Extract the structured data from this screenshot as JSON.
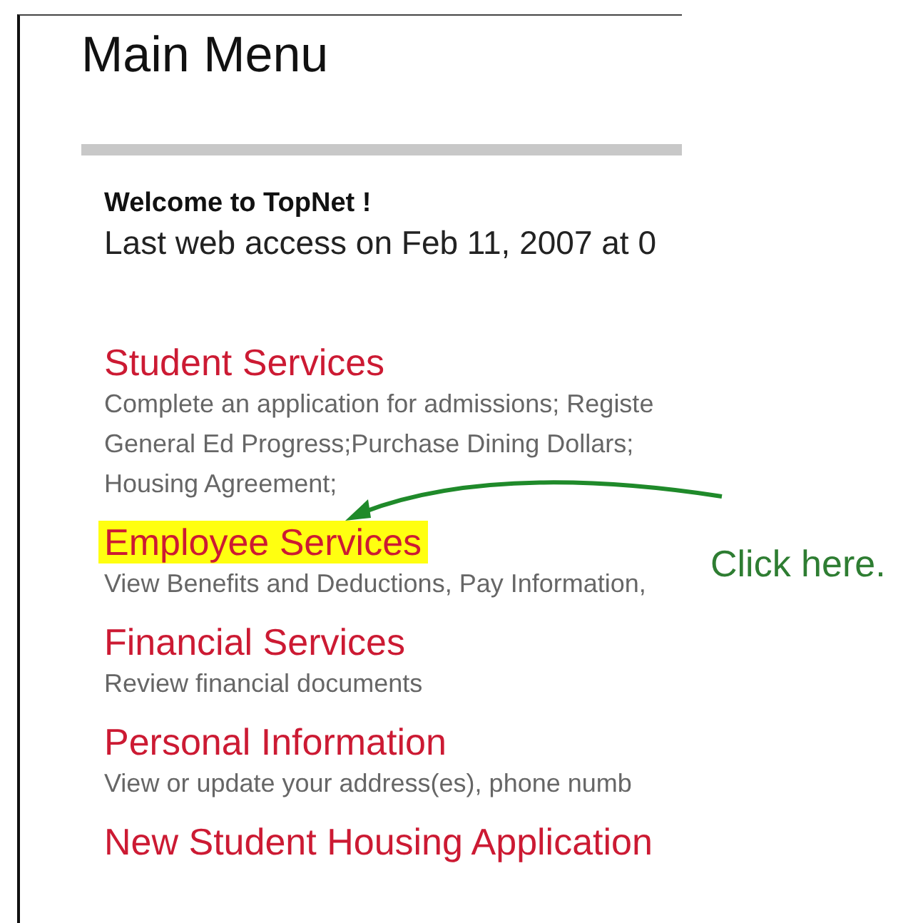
{
  "page": {
    "title": "Main Menu"
  },
  "welcome": {
    "heading": "Welcome to TopNet !",
    "last_access": "Last web access on Feb 11, 2007 at 0"
  },
  "services": [
    {
      "title": "Student Services",
      "highlighted": false,
      "description": [
        "Complete an application for admissions; Registe",
        "General Ed Progress;Purchase Dining Dollars;",
        "Housing Agreement;"
      ]
    },
    {
      "title": "Employee Services",
      "highlighted": true,
      "description": [
        "View Benefits and Deductions, Pay Information,"
      ]
    },
    {
      "title": "Financial Services",
      "highlighted": false,
      "description": [
        "Review financial documents"
      ]
    },
    {
      "title": "Personal Information",
      "highlighted": false,
      "description": [
        "View or update your address(es), phone numb"
      ]
    },
    {
      "title": "New Student Housing Application",
      "highlighted": false
    }
  ],
  "callout": {
    "text": "Click here."
  }
}
